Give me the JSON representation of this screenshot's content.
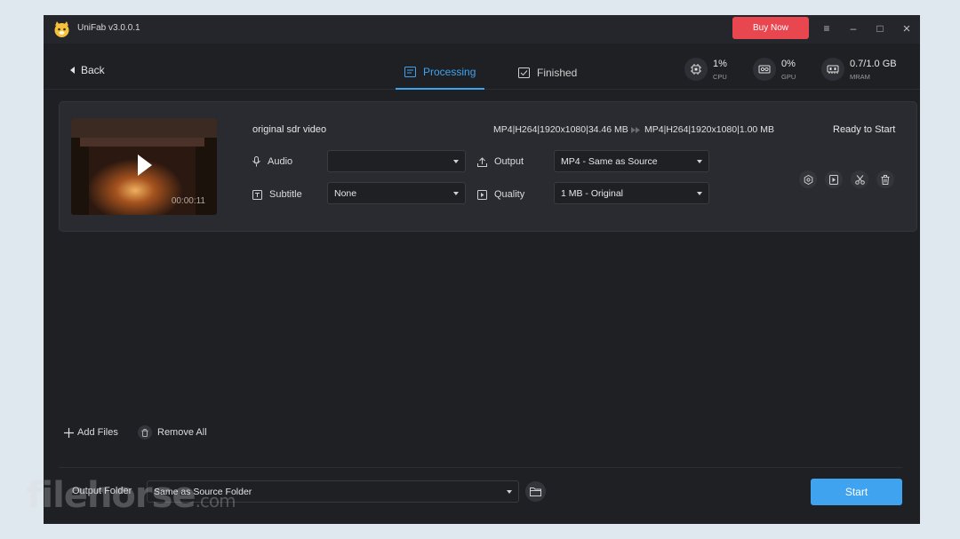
{
  "app": {
    "title": "UniFab v3.0.0.1",
    "buy_label": "Buy Now"
  },
  "window_controls": {
    "menu": "≡",
    "minimize": "–",
    "maximize": "□",
    "close": "×"
  },
  "nav": {
    "back_label": "Back",
    "tabs": [
      {
        "label": "Processing",
        "active": true
      },
      {
        "label": "Finished",
        "active": false
      }
    ]
  },
  "stats": [
    {
      "value": "1%",
      "label": "CPU",
      "icon": "cpu-icon"
    },
    {
      "value": "0%",
      "label": "GPU",
      "icon": "gpu-icon"
    },
    {
      "value": "0.7/1.0 GB",
      "label": "MRAM",
      "icon": "memory-icon"
    }
  ],
  "task": {
    "filename": "original sdr video",
    "duration": "00:00:11",
    "source_format": "MP4|H264|1920x1080|34.46 MB",
    "target_format": "MP4|H264|1920x1080|1.00 MB",
    "status": "Ready to Start",
    "audio_label": "Audio",
    "audio_value": "",
    "subtitle_label": "Subtitle",
    "subtitle_value": "None",
    "output_label": "Output",
    "output_value": "MP4 - Same as Source",
    "quality_label": "Quality",
    "quality_value": "1 MB - Original"
  },
  "bottom": {
    "add_files_label": "Add Files",
    "remove_all_label": "Remove All",
    "output_folder_label": "Output Folder",
    "output_folder_value": "Same as Source Folder",
    "start_label": "Start"
  },
  "watermark": {
    "main": "filehorse",
    "suffix": ".com"
  },
  "colors": {
    "accent": "#3fa3f0",
    "buy": "#e84750",
    "background": "#1f2024",
    "card": "#2a2b30"
  }
}
